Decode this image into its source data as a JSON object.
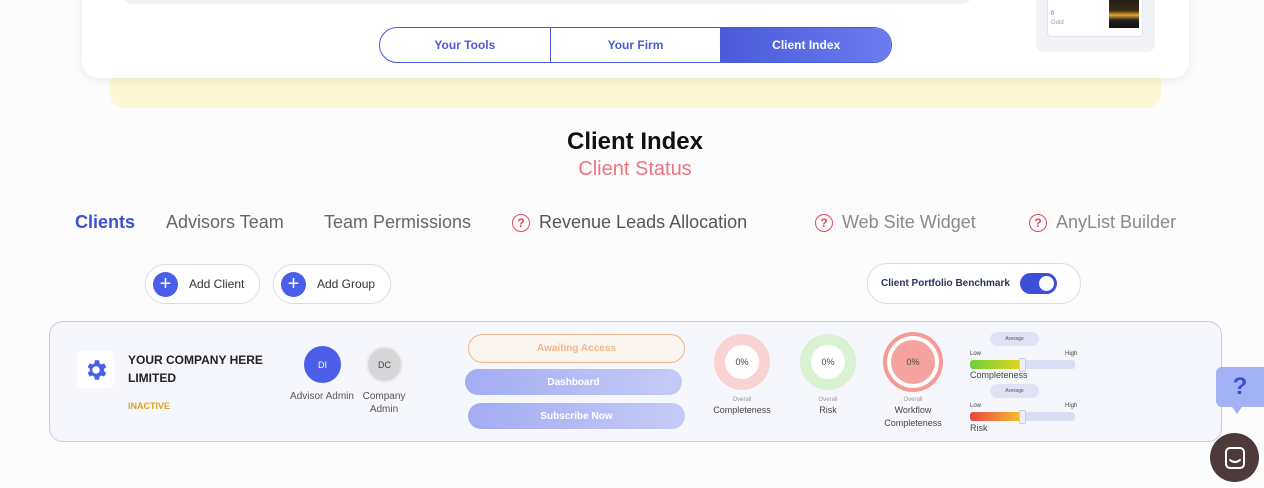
{
  "top_nav": {
    "tabs": [
      {
        "label": "Your Tools",
        "active": false
      },
      {
        "label": "Your Firm",
        "active": false
      },
      {
        "label": "Client Index",
        "active": true
      }
    ]
  },
  "side_badge": {
    "count": "0",
    "label": "Gold"
  },
  "page": {
    "title": "Client Index",
    "subtitle": "Client Status"
  },
  "tabs": [
    {
      "label": "Clients",
      "active": true,
      "help": false
    },
    {
      "label": "Advisors Team",
      "active": false,
      "help": false
    },
    {
      "label": "Team Permissions",
      "active": false,
      "help": false
    },
    {
      "label": "Revenue Leads Allocation",
      "active": false,
      "help": true
    },
    {
      "label": "Web Site Widget",
      "active": false,
      "help": true
    },
    {
      "label": "AnyList Builder",
      "active": false,
      "help": true
    }
  ],
  "actions": {
    "add_client": "Add Client",
    "add_group": "Add Group"
  },
  "benchmark": {
    "label": "Client Portfolio Benchmark",
    "enabled": true
  },
  "client": {
    "name": "YOUR COMPANY HERE LIMITED",
    "status": "INACTIVE",
    "advisor": {
      "initials": "DI",
      "label": "Advisor Admin"
    },
    "company": {
      "initials": "DC",
      "label": "Company Admin"
    },
    "buttons": {
      "awaiting": "Awaiting Access",
      "dashboard": "Dashboard",
      "subscribe": "Subscribe Now"
    },
    "rings": [
      {
        "value": "0%",
        "small": "Overall",
        "label": "Completeness"
      },
      {
        "value": "0%",
        "small": "Overall",
        "label": "Risk"
      },
      {
        "value": "0%",
        "small": "Overall",
        "label": "Workflow Completeness"
      }
    ],
    "gauges": [
      {
        "pill": "Average",
        "low": "Low",
        "high": "High",
        "title": "Completeness",
        "level": 0.5
      },
      {
        "pill": "Average",
        "low": "Low",
        "high": "High",
        "title": "Risk",
        "level": 0.5
      }
    ]
  },
  "colors": {
    "accent": "#4a5ee8",
    "danger": "#e04b5c",
    "inactive": "#e0a21a",
    "subtitle": "#f0737f"
  },
  "help": {
    "symbol": "?"
  }
}
